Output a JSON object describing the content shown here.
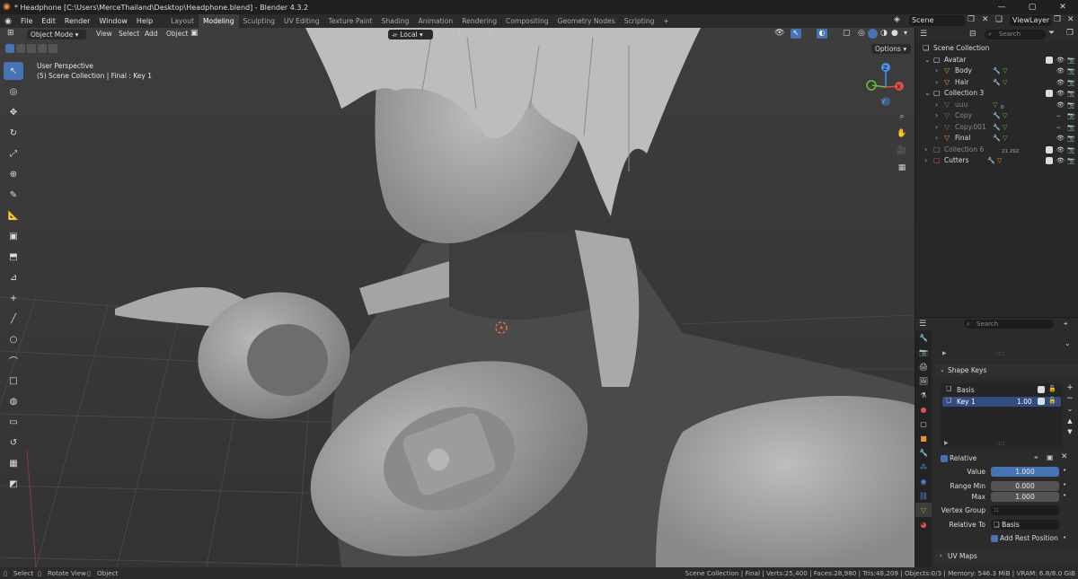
{
  "window": {
    "title": "* Headphone [C:\\Users\\MerceThailand\\Desktop\\Headphone.blend] - Blender 4.3.2",
    "controls": [
      "—",
      "▢",
      "✕"
    ]
  },
  "menu": [
    "File",
    "Edit",
    "Render",
    "Window",
    "Help"
  ],
  "workspaces": [
    "Layout",
    "Modeling",
    "Sculpting",
    "UV Editing",
    "Texture Paint",
    "Shading",
    "Animation",
    "Rendering",
    "Compositing",
    "Geometry Nodes",
    "Scripting"
  ],
  "active_workspace": "Modeling",
  "scene": {
    "scene_label": "Scene",
    "view_layer_label": "ViewLayer"
  },
  "viewport": {
    "mode": "Object Mode",
    "menus": [
      "View",
      "Select",
      "Add",
      "Object"
    ],
    "transform_orientation": "Local",
    "options_label": "Options",
    "overlay_line1": "User Perspective",
    "overlay_line2": "(5) Scene Collection | Final : Key 1",
    "gizmo_axes": {
      "z": "Z",
      "x": "X",
      "y": "Y"
    }
  },
  "outliner": {
    "search_placeholder": "Search",
    "rows": [
      {
        "label": "Scene Collection",
        "depth": 0,
        "kind": "scene"
      },
      {
        "label": "Avatar",
        "depth": 1,
        "kind": "collection"
      },
      {
        "label": "Body",
        "depth": 2,
        "kind": "object"
      },
      {
        "label": "Hair",
        "depth": 2,
        "kind": "object"
      },
      {
        "label": "Collection 3",
        "depth": 1,
        "kind": "collection"
      },
      {
        "label": "uuu",
        "depth": 2,
        "kind": "object-dim"
      },
      {
        "label": "Copy",
        "depth": 2,
        "kind": "object-dim"
      },
      {
        "label": "Copy.001",
        "depth": 2,
        "kind": "object-dim"
      },
      {
        "label": "Final",
        "depth": 2,
        "kind": "object"
      },
      {
        "label": "Collection 6",
        "depth": 1,
        "kind": "collection-dim"
      },
      {
        "label": "Cutters",
        "depth": 1,
        "kind": "collection-red"
      }
    ],
    "badge_uuu": "0",
    "badge_collection6": "21 292"
  },
  "properties": {
    "search_placeholder": "Search",
    "shape_keys_label": "Shape Keys",
    "keys": [
      {
        "name": "Basis",
        "value": ""
      },
      {
        "name": "Key 1",
        "value": "1.00"
      }
    ],
    "relative_label": "Relative",
    "value_label": "Value",
    "value": "1.000",
    "range_min_label": "Range Min",
    "range_min": "0.000",
    "max_label": "Max",
    "max": "1.000",
    "vertex_group_label": "Vertex Group",
    "relative_to_label": "Relative To",
    "relative_to": "Basis",
    "add_rest_position_label": "Add Rest Position",
    "uv_maps_label": "UV Maps"
  },
  "status": {
    "select": "Select",
    "rotate": "Rotate View",
    "object": "Object",
    "stats": "Scene Collection | Final | Verts:25,400 | Faces:28,980 | Tris:48,209 | Objects:0/3 | Memory: 546.3 MiB | VRAM: 6.8/8.0 GiB"
  },
  "colors": {
    "accent": "#4772b3",
    "orange": "#e8923a",
    "green": "#6cbf3a",
    "red": "#e05050"
  }
}
